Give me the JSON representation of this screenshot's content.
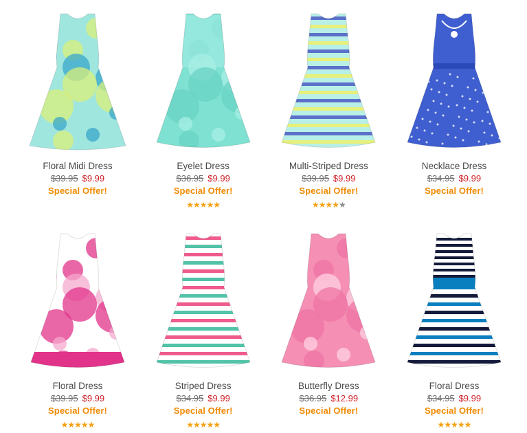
{
  "products": [
    {
      "name": "Floral Midi Dress",
      "was": "$39.95",
      "now": "$9.99",
      "offer": "Special Offer!",
      "rating": 0,
      "icon": "floral-midi-dress-image",
      "colors": {
        "base": "#9fe6de",
        "accent": "#d9ef7a",
        "pattern": "#3aa7c9"
      }
    },
    {
      "name": "Eyelet Dress",
      "was": "$36.95",
      "now": "$9.99",
      "offer": "Special Offer!",
      "rating": 5,
      "icon": "eyelet-dress-image",
      "colors": {
        "base": "#7fe1d2",
        "accent": "#6ad3c3",
        "pattern": "#a8efe6"
      }
    },
    {
      "name": "Multi-Striped Dress",
      "was": "$39.95",
      "now": "$9.99",
      "offer": "Special Offer!",
      "rating": 4.5,
      "icon": "multi-striped-dress-image",
      "colors": {
        "base": "#b8f0e8",
        "accent": "#5c70c9",
        "pattern": "#e6f07a"
      }
    },
    {
      "name": "Necklace Dress",
      "was": "$34.95",
      "now": "$9.99",
      "offer": "Special Offer!",
      "rating": 0,
      "icon": "necklace-dress-image",
      "colors": {
        "base": "#3f5fd0",
        "accent": "#2b49b8",
        "pattern": "#ffffff"
      }
    },
    {
      "name": "Floral Dress",
      "was": "$39.95",
      "now": "$9.99",
      "offer": "Special Offer!",
      "rating": 5,
      "icon": "pink-floral-dress-image",
      "colors": {
        "base": "#ffffff",
        "accent": "#e1338a",
        "pattern": "#f6a9cf"
      }
    },
    {
      "name": "Striped Dress",
      "was": "$34.95",
      "now": "$9.99",
      "offer": "Special Offer!",
      "rating": 5,
      "icon": "striped-dress-image",
      "colors": {
        "base": "#ffffff",
        "accent": "#ef5b8b",
        "pattern": "#52c3a8"
      }
    },
    {
      "name": "Butterfly Dress",
      "was": "$36.95",
      "now": "$12.99",
      "offer": "Special Offer!",
      "rating": 0,
      "icon": "butterfly-dress-image",
      "colors": {
        "base": "#f58fb4",
        "accent": "#ef74a4",
        "pattern": "#ffd2e3"
      }
    },
    {
      "name": "Floral Dress",
      "was": "$34.95",
      "now": "$9.99",
      "offer": "Special Offer!",
      "rating": 5,
      "icon": "black-white-floral-dress-image",
      "colors": {
        "base": "#ffffff",
        "accent": "#0a7fc0",
        "pattern": "#141a3a"
      }
    }
  ]
}
